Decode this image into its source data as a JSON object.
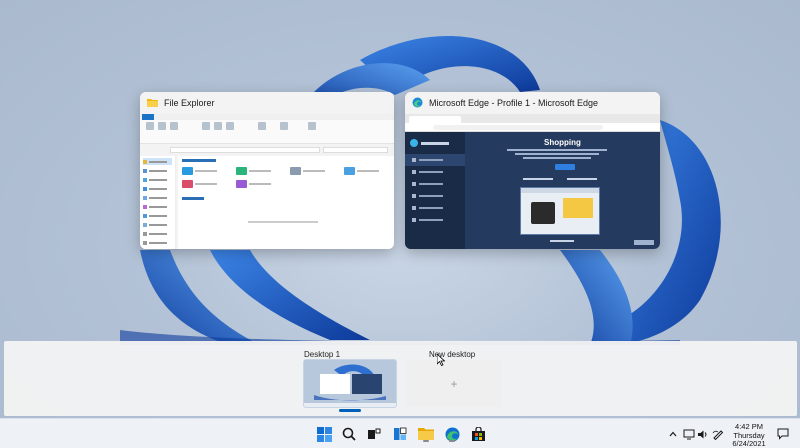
{
  "windows": [
    {
      "title": "File Explorer",
      "icon": "folder-icon"
    },
    {
      "title": "Microsoft Edge - Profile 1 - Microsoft Edge",
      "icon": "edge-icon"
    }
  ],
  "edge_page": {
    "heading": "Shopping"
  },
  "desktops": {
    "current_label": "Desktop 1",
    "new_label": "New desktop",
    "new_symbol": "+"
  },
  "taskbar": {
    "apps": [
      "start-icon",
      "search-icon",
      "task-view-icon",
      "widgets-icon",
      "file-explorer-icon",
      "edge-icon",
      "store-icon"
    ],
    "tray": [
      "chevron-up-icon",
      "network-icon",
      "volume-icon",
      "pen-icon",
      "notification-icon"
    ],
    "time": "4:42 PM",
    "day": "Thursday",
    "date": "6/24/2021"
  },
  "colors": {
    "accent": "#005fb8",
    "wallpaper": "#b7c6d8",
    "bloom": "#1f5ec4"
  }
}
